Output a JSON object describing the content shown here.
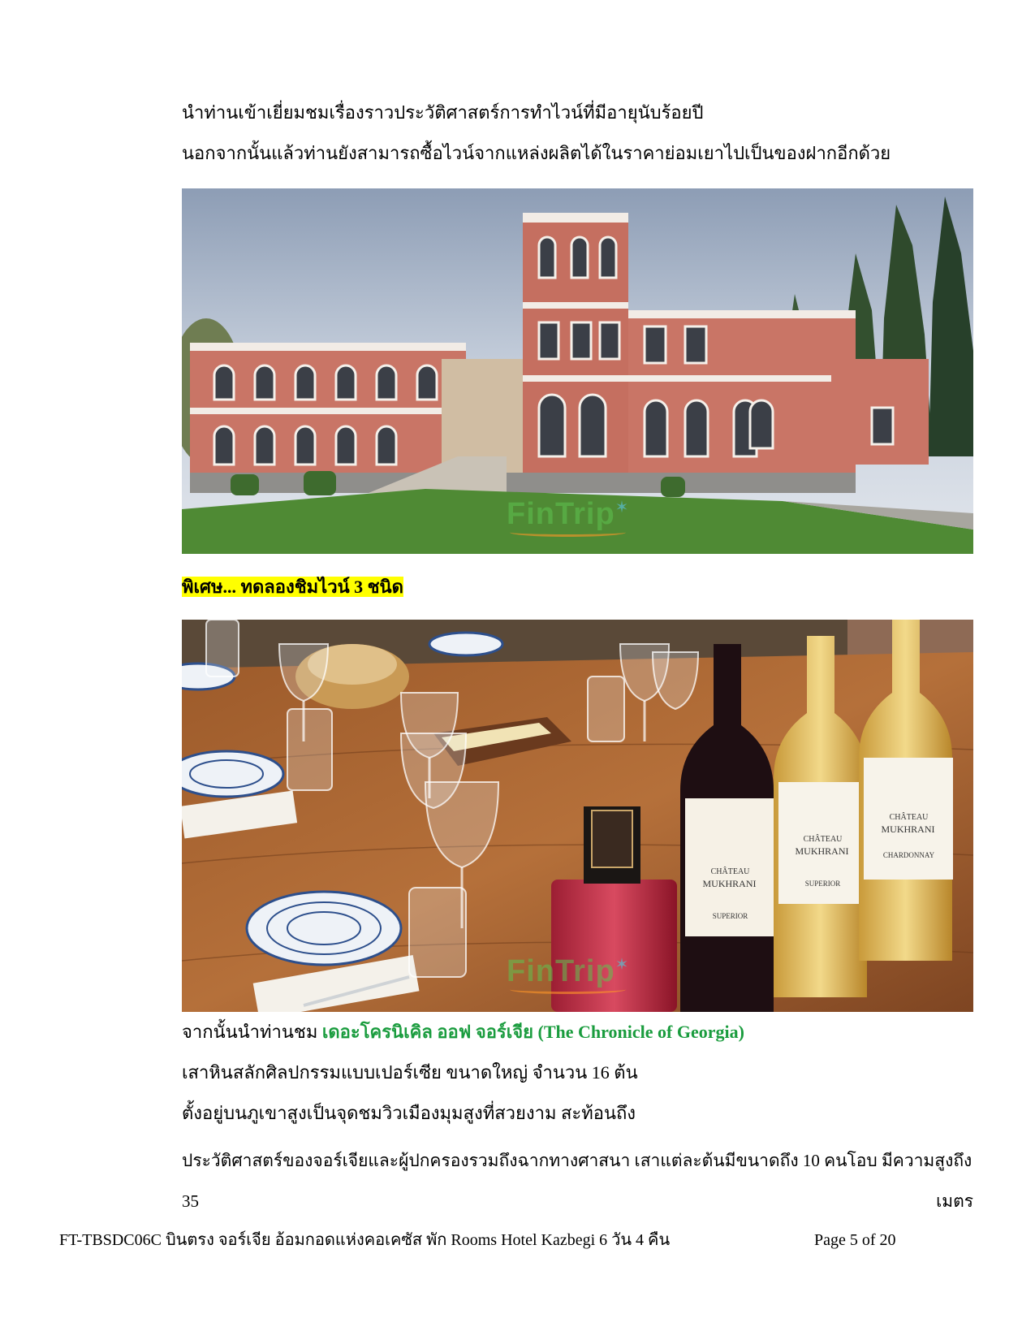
{
  "intro": {
    "line1": "นำท่านเข้าเยี่ยมชมเรื่องราวประวัติศาสตร์การทำไวน์ที่มีอายุนับร้อยปี",
    "line2": "นอกจากนั้นแล้วท่านยังสามารถซื้อไวน์จากแหล่งผลิตได้ในราคาย่อมเยาไปเป็นของฝากอีกด้วย"
  },
  "watermark_text": "FinTrip",
  "special_label": "พิเศษ... ทดลองชิมไวน์ 3 ชนิด",
  "bottle_labels": {
    "chateau": "CHÂTEAU",
    "mukhrani": "MUKHRANI",
    "wine1": "SUPERIOR",
    "wine2": "SUPERIOR",
    "wine3": "CHARDONNAY"
  },
  "chronicle": {
    "prefix": "จากนั้นนำท่านชม ",
    "name": "เดอะโครนิเคิล ออฟ จอร์เจีย (The Chronicle of Georgia)",
    "line2": "เสาหินสลักศิลปกรรมแบบเปอร์เซีย ขนาดใหญ่ จำนวน 16 ต้น",
    "line3": "ตั้งอยู่บนภูเขาสูงเป็นจุดชมวิวเมืองมุมสูงที่สวยงาม สะท้อนถึง",
    "line4": "ประวัติศาสตร์ของจอร์เจียและผู้ปกครองรวมถึงฉากทางศาสนา เสาแต่ละต้นมีขนาดถึง 10 คนโอบ มีความสูงถึง",
    "line5_left": "35",
    "line5_right": "เมตร"
  },
  "footer": {
    "title": "FT-TBSDC06C บินตรง จอร์เจีย อ้อมกอดแห่งคอเคซัส พัก Rooms Hotel Kazbegi 6 วัน 4 คืน",
    "page": "Page 5 of 20"
  }
}
